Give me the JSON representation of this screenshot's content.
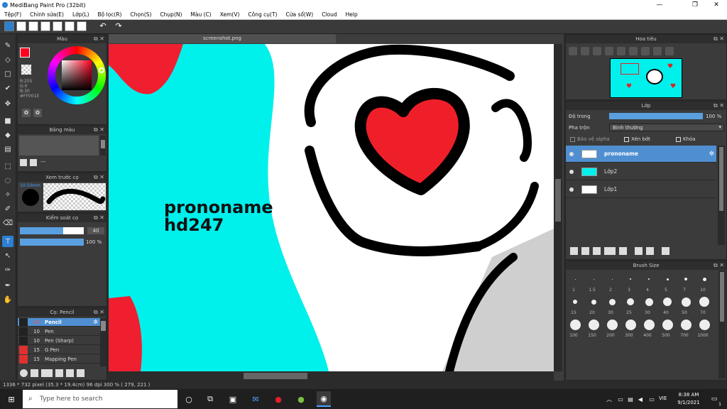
{
  "window": {
    "title": "MediBang Paint Pro (32bit)"
  },
  "menu": [
    "Tệp(F)",
    "Chỉnh sửa(E)",
    "Lớp(L)",
    "Bộ lọc(R)",
    "Chọn(S)",
    "Chụp(N)",
    "Màu (C)",
    "Xem(V)",
    "Công cụ(T)",
    "Cửa sổ(W)",
    "Cloud",
    "Help"
  ],
  "color_panel": {
    "title": "Màu",
    "r": "R:255",
    "g": "G:0",
    "b": "B:30",
    "hex": "#FF001E",
    "fg": "#ff001e"
  },
  "palette_panel": {
    "title": "Bảng màu",
    "placeholder": "---"
  },
  "brush_preview": {
    "title": "Xem trước cọ",
    "size": "10.50mm"
  },
  "brush_control": {
    "title": "Kiểm soát cọ",
    "size_value": "40",
    "opacity_value": "100 %",
    "size_frac": 0.68,
    "opacity_frac": 1.0
  },
  "brush_list": {
    "title": "Cọ: Pencil",
    "items": [
      {
        "size": "40",
        "name": "Pencil",
        "color": "#222"
      },
      {
        "size": "10",
        "name": "Pen",
        "color": "#222"
      },
      {
        "size": "10",
        "name": "Pen (Sharp)",
        "color": "#222"
      },
      {
        "size": "15",
        "name": "G Pen",
        "color": "#e03030"
      },
      {
        "size": "15",
        "name": "Mapping Pen",
        "color": "#e03030"
      }
    ]
  },
  "canvas": {
    "tab": "screenshot.png",
    "text_line1": "prononame",
    "text_line2": "hd247"
  },
  "navigator": {
    "title": "Hoa tiêu"
  },
  "layer_panel": {
    "title": "Lớp",
    "opacity_label": "Độ trong",
    "opacity_value": "100 %",
    "blend_label": "Pha trộn",
    "blend_value": "Bình thường",
    "protect_alpha": "Bảo vệ alpha",
    "clipping": "Xén bớt",
    "lock": "Khóa",
    "layers": [
      {
        "name": "prononame",
        "selected": true
      },
      {
        "name": "Lớp2",
        "selected": false
      },
      {
        "name": "Lớp1",
        "selected": false
      }
    ]
  },
  "brush_size": {
    "title": "Brush Size",
    "sizes": [
      "1",
      "1.5",
      "2",
      "3",
      "4",
      "5",
      "7",
      "10",
      "15",
      "20",
      "30",
      "25",
      "30",
      "40",
      "50",
      "70",
      "100",
      "150",
      "200",
      "300",
      "400",
      "500",
      "700",
      "1000"
    ]
  },
  "status": {
    "text": "1336 * 732 pixel  (35.3 * 19.4cm)  96 dpi  300 %  ( 279, 221 )"
  },
  "taskbar": {
    "search_placeholder": "Type here to search",
    "time": "8:38 AM",
    "date": "9/1/2021",
    "lang": "VIE",
    "notif": "1"
  }
}
